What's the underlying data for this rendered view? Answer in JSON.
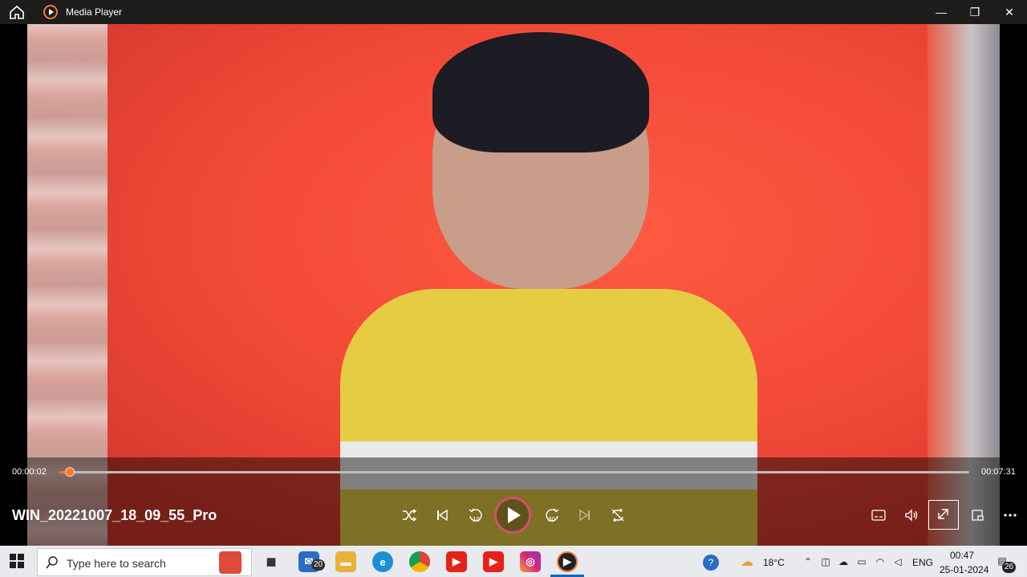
{
  "app": {
    "title": "Media Player"
  },
  "window_controls": {
    "minimize": "—",
    "restore": "❐",
    "close": "✕"
  },
  "player": {
    "current_time": "00:00:02",
    "total_time": "00:07:31",
    "progress_fraction": 0.0044,
    "filename": "WIN_20221007_18_09_55_Pro",
    "rewind_label": "10",
    "forward_label": "30",
    "state": "paused"
  },
  "taskbar": {
    "search_placeholder": "Type here to search",
    "mail_badge": "20",
    "notification_badge": "26",
    "weather": "18°C",
    "language": "ENG",
    "clock_time": "00:47",
    "clock_date": "25-01-2024"
  },
  "colors": {
    "accent": "#ff6f3b",
    "play_ring": "#d4506d",
    "titlebar": "#1f1d1c",
    "taskbar": "#e8eaed"
  }
}
